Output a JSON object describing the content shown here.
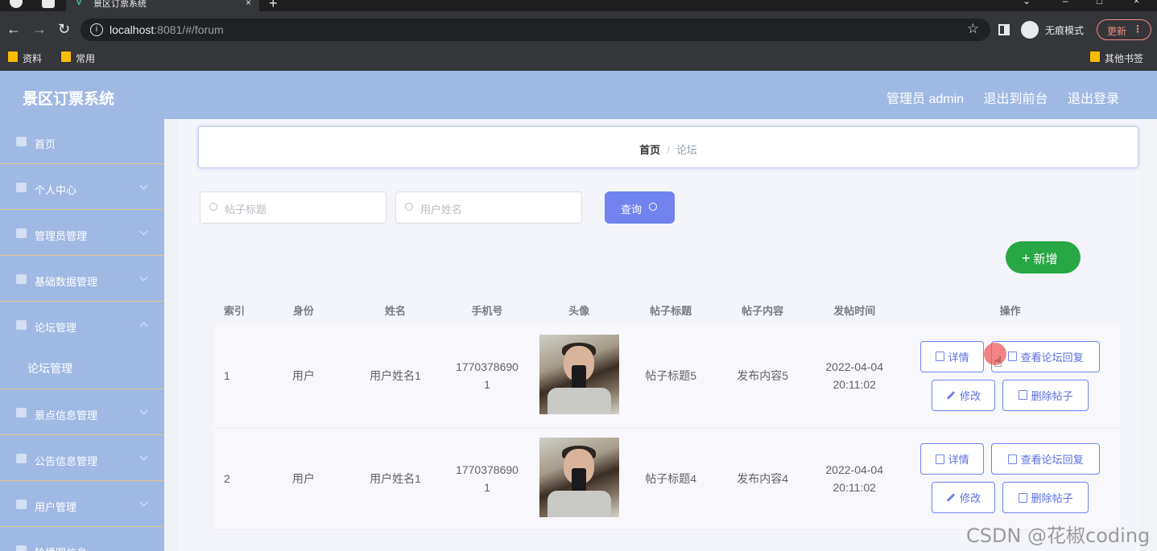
{
  "browser": {
    "tab_title": "景区订票系统",
    "tab_close": "×",
    "new_tab": "+",
    "url_host": "localhost",
    "url_rest": ":8081/#/forum",
    "incognito_label": "无痕模式",
    "update_label": "更新",
    "bookmarks": [
      "资料",
      "常用"
    ],
    "other_bookmarks": "其他书签"
  },
  "app": {
    "title": "景区订票系统",
    "user_label": "管理员 admin",
    "exit_front": "退出到前台",
    "logout": "退出登录"
  },
  "sidebar": {
    "items": [
      {
        "label": "首页",
        "icon": "home-icon"
      },
      {
        "label": "个人中心",
        "icon": "user-icon"
      },
      {
        "label": "管理员管理",
        "icon": "megaphone-icon"
      },
      {
        "label": "基础数据管理",
        "icon": "mic-icon"
      },
      {
        "label": "论坛管理",
        "icon": "doc-icon"
      },
      {
        "label": "论坛管理",
        "icon": ""
      },
      {
        "label": "景点信息管理",
        "icon": "doc-icon"
      },
      {
        "label": "公告信息管理",
        "icon": "flag-icon"
      },
      {
        "label": "用户管理",
        "icon": "panel-icon"
      },
      {
        "label": "轮播图信息",
        "icon": "image-icon"
      }
    ]
  },
  "breadcrumb": {
    "home": "首页",
    "separator": "/",
    "current": "论坛"
  },
  "search": {
    "title_placeholder": "帖子标题",
    "name_placeholder": "用户姓名",
    "button": "查询"
  },
  "add_button": "新增",
  "table": {
    "headers": [
      "索引",
      "身份",
      "姓名",
      "手机号",
      "头像",
      "帖子标题",
      "帖子内容",
      "发帖时间",
      "操作"
    ],
    "rows": [
      {
        "index": "1",
        "role": "用户",
        "name": "用户姓名1",
        "phone_a": "1770378690",
        "phone_b": "1",
        "title": "帖子标题5",
        "content": "发布内容5",
        "date": "2022-04-04",
        "time": "20:11:02"
      },
      {
        "index": "2",
        "role": "用户",
        "name": "用户姓名1",
        "phone_a": "1770378690",
        "phone_b": "1",
        "title": "帖子标题4",
        "content": "发布内容4",
        "date": "2022-04-04",
        "time": "20:11:02"
      }
    ],
    "actions": {
      "detail": "详情",
      "replies": "查看论坛回复",
      "edit": "修改",
      "delete": "删除帖子"
    }
  },
  "watermark": "CSDN @花椒coding"
}
